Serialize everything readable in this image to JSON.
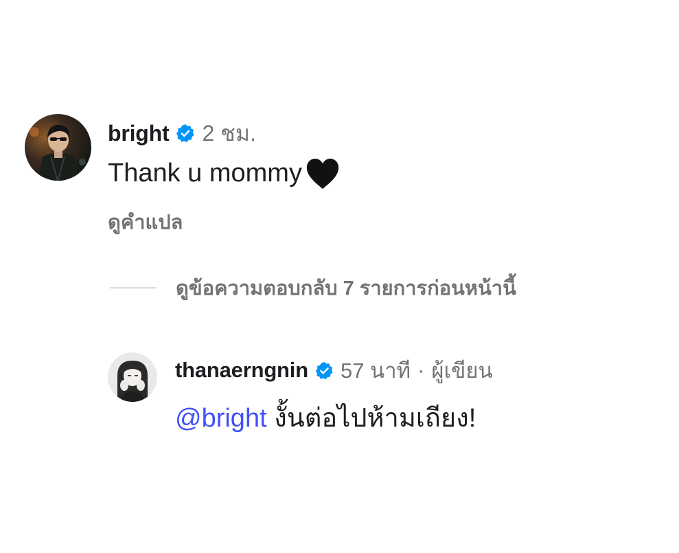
{
  "colors": {
    "text": "#1c1e21",
    "secondary": "#737373",
    "verified": "#0095f6",
    "mention": "#4150f7",
    "divider": "#dbdbdb"
  },
  "comment": {
    "username": "bright",
    "verified_icon": "verified-badge-icon",
    "timestamp": "2 ชม.",
    "text": "Thank u mommy",
    "emoji": "black-heart-icon",
    "translate_label": "ดูคำแปล"
  },
  "view_previous_replies": {
    "label": "ดูข้อความตอบกลับ 7 รายการก่อนหน้านี้"
  },
  "reply": {
    "username": "thanaerngnin",
    "verified_icon": "verified-badge-icon",
    "timestamp": "57 นาที",
    "separator": "·",
    "author_badge": "ผู้เขียน",
    "mention": "@bright",
    "text": " งั้นต่อไปห้ามเถียง!"
  }
}
